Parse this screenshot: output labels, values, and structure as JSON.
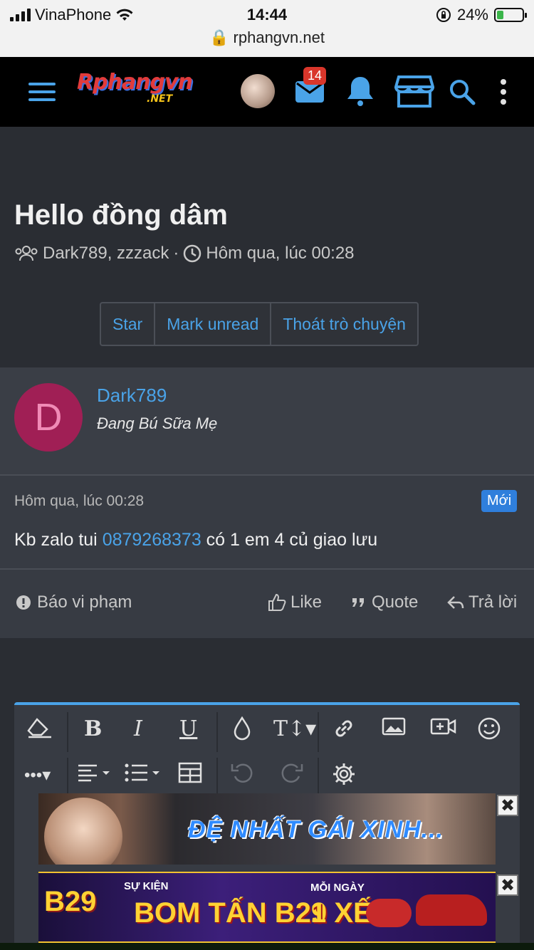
{
  "statusbar": {
    "carrier": "VinaPhone",
    "time": "14:44",
    "battery": "24%",
    "url": "rphangvn.net"
  },
  "header": {
    "logo_main": "Rphangvn",
    "logo_sub": ".NET",
    "mail_badge": "14"
  },
  "thread": {
    "title": "Hello đồng dâm",
    "participants": "Dark789, zzzack",
    "date": "Hôm qua, lúc 00:28",
    "actions": [
      "Star",
      "Mark unread",
      "Thoát trò chuyện"
    ]
  },
  "message": {
    "avatar_letter": "D",
    "username": "Dark789",
    "user_title": "Đang Bú Sữa Mẹ",
    "time": "Hôm qua, lúc 00:28",
    "new_label": "Mới",
    "body_before": "Kb zalo tui ",
    "body_link": "0879268373",
    "body_after": " có 1 em 4 củ giao lưu",
    "report_label": "Báo vi phạm",
    "like_label": "Like",
    "quote_label": "Quote",
    "reply_label": "Trả lời"
  },
  "ads": {
    "ad1_text": "ĐỆ NHẤT GÁI XINH...",
    "ad2_brand": "B29",
    "ad2_event": "SỰ KIỆN",
    "ad2_main": "BOM TẤN B29",
    "ad2_daily": "MỖI NGÀY",
    "ad2_prize": "1 XẾ",
    "close": "✖"
  },
  "colors": {
    "accent": "#4aa3e8",
    "header_bg": "#000000",
    "page_bg": "#2a2d33",
    "card_bg": "#373b43",
    "avatar_bg": "#a01f55",
    "new_badge": "#2f7fdc"
  }
}
